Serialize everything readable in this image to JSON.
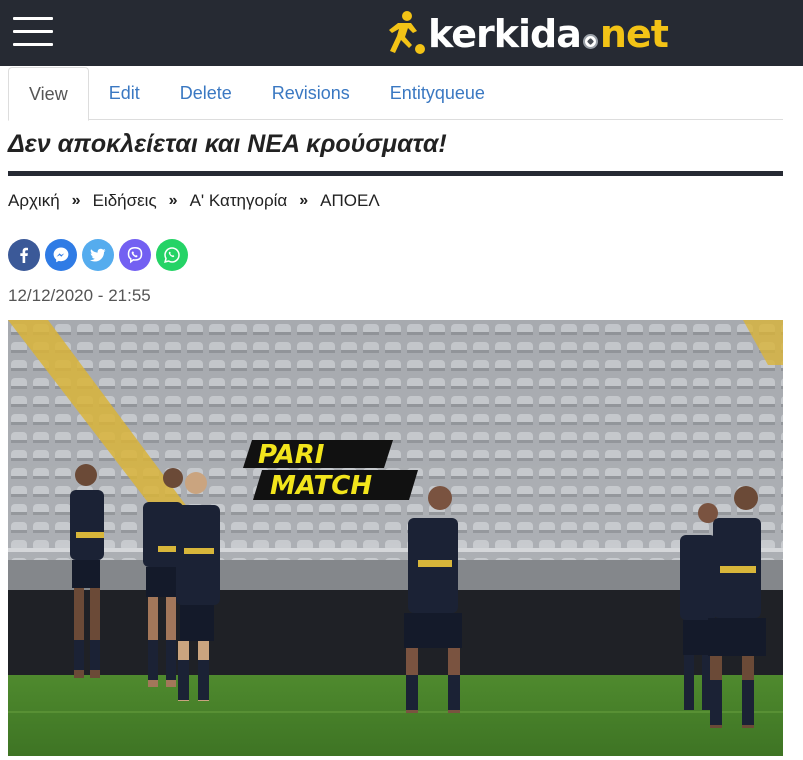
{
  "header": {
    "menu_icon": "hamburger-menu-icon",
    "logo": {
      "part1": "kerkida",
      "part2": "net",
      "mark_icon": "footballer-kick-icon"
    }
  },
  "colors": {
    "header_bg": "#262a33",
    "logo_accent": "#f3c316",
    "link": "#3a78c2"
  },
  "tabs": [
    {
      "label": "View",
      "active": true
    },
    {
      "label": "Edit",
      "active": false
    },
    {
      "label": "Delete",
      "active": false
    },
    {
      "label": "Revisions",
      "active": false
    },
    {
      "label": "Entityqueue",
      "active": false
    }
  ],
  "article": {
    "title": "Δεν αποκλείεται και ΝΕΑ κρούσματα!",
    "breadcrumb": [
      {
        "label": "Αρχική"
      },
      {
        "label": "Ειδήσεις"
      },
      {
        "label": "Α' Κατηγορία"
      },
      {
        "label": "ΑΠΟΕΛ"
      }
    ],
    "breadcrumb_separator": "»",
    "share": [
      {
        "network": "facebook",
        "icon": "facebook-icon",
        "color": "#3b5998"
      },
      {
        "network": "messenger",
        "icon": "messenger-icon",
        "color": "#2f7be5"
      },
      {
        "network": "twitter",
        "icon": "twitter-icon",
        "color": "#55acee"
      },
      {
        "network": "viber",
        "icon": "viber-icon",
        "color": "#7360f2"
      },
      {
        "network": "whatsapp",
        "icon": "whatsapp-icon",
        "color": "#25d366"
      }
    ],
    "date": "12/12/2020 - 21:55",
    "image": {
      "description_icon": "article-photo",
      "banner_line1": "PARI",
      "banner_line2": "MATCH"
    }
  }
}
